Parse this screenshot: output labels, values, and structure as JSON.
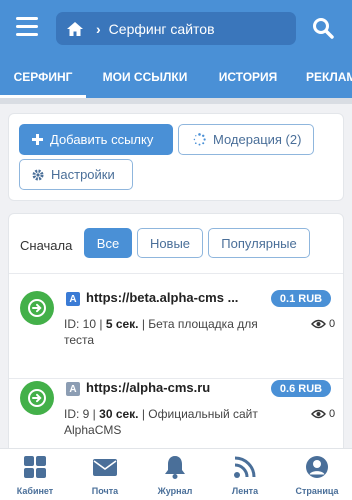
{
  "header": {
    "breadcrumb": "Серфинг сайтов",
    "home_icon": "home-icon",
    "menu_icon": "hamburger-icon",
    "search_icon": "search-icon",
    "color": "#4a90d6"
  },
  "tabs": [
    {
      "label": "СЕРФИНГ",
      "active": true
    },
    {
      "label": "МОИ ССЫЛКИ",
      "active": false
    },
    {
      "label": "ИСТОРИЯ",
      "active": false
    },
    {
      "label": "РЕКЛАМ",
      "active": false
    }
  ],
  "actions": {
    "add_link": "Добавить ссылку",
    "moderation": "Модерация (2)",
    "settings": "Настройки"
  },
  "filter": {
    "label": "Сначала",
    "options": [
      {
        "label": "Все",
        "selected": true
      },
      {
        "label": "Новые",
        "selected": false
      },
      {
        "label": "Популярные",
        "selected": false
      }
    ]
  },
  "sites": [
    {
      "url": "https://beta.alpha-cms ...",
      "favicon": "A",
      "favicon_color": "#3a7bd5",
      "price": "0.1 RUB",
      "id_text": "ID: 10 | ",
      "duration": "5 сек.",
      "description": " | Бета площадка для теста",
      "views": "0"
    },
    {
      "url": "https://alpha-cms.ru",
      "favicon": "A",
      "favicon_color": "#8c9db3",
      "price": "0.6 RUB",
      "id_text": "ID: 9 | ",
      "duration": "30 сек.",
      "description": " | Официальный сайт AlphaCMS",
      "views": "0"
    }
  ],
  "bottom_nav": [
    {
      "label": "Кабинет",
      "icon": "grid-icon"
    },
    {
      "label": "Почта",
      "icon": "mail-icon"
    },
    {
      "label": "Журнал",
      "icon": "bell-icon"
    },
    {
      "label": "Лента",
      "icon": "rss-icon"
    },
    {
      "label": "Страница",
      "icon": "user-icon"
    }
  ]
}
